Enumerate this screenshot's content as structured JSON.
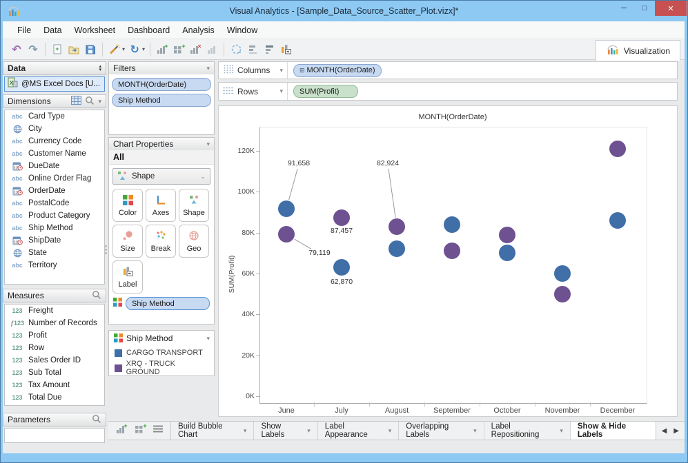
{
  "window": {
    "title": "Visual Analytics - [Sample_Data_Source_Scatter_Plot.vizx]*"
  },
  "menu": {
    "items": [
      "File",
      "Data",
      "Worksheet",
      "Dashboard",
      "Analysis",
      "Window"
    ]
  },
  "toolbar": {
    "groups": [
      {
        "items": [
          {
            "name": "undo-icon"
          },
          {
            "name": "redo-icon"
          }
        ]
      },
      {
        "items": [
          {
            "name": "new-document-icon"
          },
          {
            "name": "open-folder-icon"
          },
          {
            "name": "save-icon"
          }
        ]
      },
      {
        "items": [
          {
            "name": "format-wand-icon",
            "dropdown": true
          },
          {
            "name": "refresh-icon",
            "dropdown": true
          }
        ]
      },
      {
        "items": [
          {
            "name": "add-chart-icon"
          },
          {
            "name": "add-dashboard-icon"
          },
          {
            "name": "delete-chart-icon"
          },
          {
            "name": "chart-disabled-icon"
          }
        ]
      },
      {
        "items": [
          {
            "name": "rotate-selection-icon"
          },
          {
            "name": "align-bars-icon"
          },
          {
            "name": "stack-bars-icon"
          },
          {
            "name": "label-chart-icon"
          }
        ]
      }
    ],
    "visualization_label": "Visualization"
  },
  "data_panel": {
    "title": "Data",
    "source": "@MS Excel Docs [U...",
    "dimensions": {
      "title": "Dimensions",
      "items": [
        {
          "icon": "text",
          "label": "Card Type"
        },
        {
          "icon": "geo",
          "label": "City"
        },
        {
          "icon": "text",
          "label": "Currency Code"
        },
        {
          "icon": "text",
          "label": "Customer Name"
        },
        {
          "icon": "date",
          "label": "DueDate"
        },
        {
          "icon": "text",
          "label": "Online Order Flag"
        },
        {
          "icon": "date",
          "label": "OrderDate"
        },
        {
          "icon": "text",
          "label": "PostalCode"
        },
        {
          "icon": "text",
          "label": "Product Category"
        },
        {
          "icon": "text",
          "label": "Ship Method"
        },
        {
          "icon": "date",
          "label": "ShipDate"
        },
        {
          "icon": "geo",
          "label": "State"
        },
        {
          "icon": "text",
          "label": "Territory"
        }
      ]
    },
    "measures": {
      "title": "Measures",
      "items": [
        {
          "icon": "num",
          "label": "Freight"
        },
        {
          "icon": "calc",
          "label": "Number of Records"
        },
        {
          "icon": "num",
          "label": "Profit"
        },
        {
          "icon": "num",
          "label": "Row"
        },
        {
          "icon": "num",
          "label": "Sales Order ID"
        },
        {
          "icon": "num",
          "label": "Sub Total"
        },
        {
          "icon": "num",
          "label": "Tax Amount"
        },
        {
          "icon": "num",
          "label": "Total Due"
        }
      ]
    },
    "parameters": {
      "title": "Parameters"
    }
  },
  "filters": {
    "title": "Filters",
    "pills": [
      "MONTH(OrderDate)",
      "Ship Method"
    ]
  },
  "chart_properties": {
    "title": "Chart Properties",
    "scope": "All",
    "dropdown_label": "Shape",
    "buttons": [
      {
        "icon": "color",
        "label": "Color"
      },
      {
        "icon": "axes",
        "label": "Axes"
      },
      {
        "icon": "shape",
        "label": "Shape"
      },
      {
        "icon": "size",
        "label": "Size"
      },
      {
        "icon": "break",
        "label": "Break"
      },
      {
        "icon": "geo",
        "label": "Geo"
      },
      {
        "icon": "label",
        "label": "Label"
      }
    ],
    "pill": "Ship Method"
  },
  "legend": {
    "title": "Ship Method",
    "items": [
      {
        "color": "#3f6fa6",
        "label": "CARGO TRANSPORT"
      },
      {
        "color": "#6e5190",
        "label": "XRQ - TRUCK GROUND"
      }
    ]
  },
  "shelves": {
    "columns_label": "Columns",
    "columns_pill": "MONTH(OrderDate)",
    "rows_label": "Rows",
    "rows_pill": "SUM(Profit)"
  },
  "bottom_tabs": {
    "icons": [
      "new-worksheet-icon",
      "new-dashboard-icon",
      "list-view-icon"
    ],
    "items": [
      {
        "label": "Build Bubble Chart",
        "dropdown": true,
        "active": false
      },
      {
        "label": "Show Labels",
        "dropdown": true,
        "active": false
      },
      {
        "label": "Label Appearance",
        "dropdown": true,
        "active": false
      },
      {
        "label": "Overlapping Labels",
        "dropdown": true,
        "active": false
      },
      {
        "label": "Label Repositioning",
        "dropdown": true,
        "active": false
      },
      {
        "label": "Show & Hide Labels",
        "dropdown": false,
        "active": true
      }
    ]
  },
  "chart_data": {
    "type": "scatter",
    "title": "MONTH(OrderDate)",
    "ylabel": "SUM(Profit)",
    "x_categories": [
      "June",
      "July",
      "August",
      "September",
      "October",
      "November",
      "December"
    ],
    "y_ticks": [
      "0K",
      "20K",
      "40K",
      "60K",
      "80K",
      "100K",
      "120K"
    ],
    "y_tick_step": 20000,
    "ylim": [
      0,
      131000
    ],
    "grid": false,
    "legend_position": "left-panel",
    "series": [
      {
        "name": "CARGO TRANSPORT",
        "color": "#3f6fa6",
        "values": [
          91658,
          62870,
          72000,
          84000,
          70000,
          60000,
          86000
        ]
      },
      {
        "name": "XRQ - TRUCK GROUND",
        "color": "#6e5190",
        "values": [
          79119,
          87457,
          82924,
          71000,
          79000,
          50000,
          121000
        ]
      }
    ],
    "annotations": [
      {
        "text": "91,658",
        "series": 0,
        "month": 0,
        "dx": 18,
        "dy": -65,
        "leader": true
      },
      {
        "text": "79,119",
        "series": 1,
        "month": 0,
        "dx": 48,
        "dy": 28,
        "leader": true
      },
      {
        "text": "87,457",
        "series": 1,
        "month": 1,
        "dx": 0,
        "dy": 20,
        "leader": false
      },
      {
        "text": "62,870",
        "series": 0,
        "month": 1,
        "dx": 0,
        "dy": 22,
        "leader": false
      },
      {
        "text": "82,924",
        "series": 1,
        "month": 2,
        "dx": -13,
        "dy": -91,
        "leader": true
      }
    ]
  }
}
